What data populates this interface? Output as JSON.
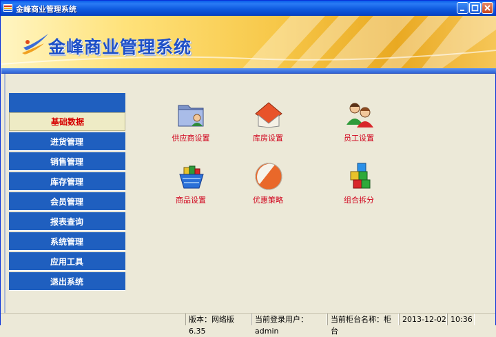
{
  "window": {
    "title": "金峰商业管理系统"
  },
  "banner": {
    "app_title": "金峰商业管理系统"
  },
  "sidebar": {
    "items": [
      {
        "label": "基础数据",
        "active": true
      },
      {
        "label": "进货管理"
      },
      {
        "label": "销售管理"
      },
      {
        "label": "库存管理"
      },
      {
        "label": "会员管理"
      },
      {
        "label": "报表查询"
      },
      {
        "label": "系统管理"
      },
      {
        "label": "应用工具"
      },
      {
        "label": "退出系统"
      }
    ]
  },
  "main": {
    "tiles": [
      {
        "label": "供应商设置",
        "icon": "supplier-folder-icon"
      },
      {
        "label": "库房设置",
        "icon": "warehouse-house-icon"
      },
      {
        "label": "员工设置",
        "icon": "staff-people-icon"
      },
      {
        "label": "商品设置",
        "icon": "goods-basket-icon"
      },
      {
        "label": "优惠策略",
        "icon": "discount-disc-icon"
      },
      {
        "label": "组合拆分",
        "icon": "combine-blocks-icon"
      }
    ]
  },
  "statusbar": {
    "version": "版本：网络版6.35",
    "user": "当前登录用户：admin",
    "counter": "当前柜台名称：柜台",
    "date": "2013-12-02",
    "time": "10:36"
  },
  "colors": {
    "menu_bg": "#1F5FBF",
    "active_text": "#D60000",
    "tile_label": "#D0001A"
  }
}
